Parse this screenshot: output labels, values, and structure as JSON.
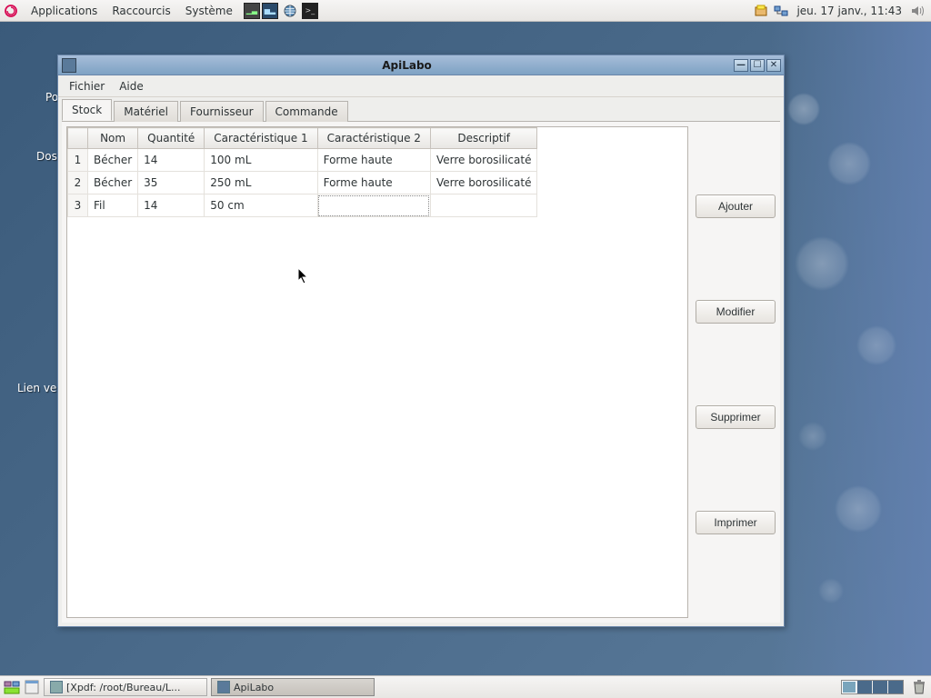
{
  "top_panel": {
    "menus": [
      "Applications",
      "Raccourcis",
      "Système"
    ],
    "clock": "jeu. 17 janv., 11:43"
  },
  "desktop_labels": {
    "poste": "Pos",
    "dossier": "Doss",
    "lien": "Lien ve"
  },
  "window": {
    "title": "ApiLabo",
    "menubar": {
      "fichier": "Fichier",
      "aide": "Aide"
    },
    "tabs": {
      "stock": "Stock",
      "materiel": "Matériel",
      "fournisseur": "Fournisseur",
      "commande": "Commande"
    },
    "table": {
      "headers": {
        "idx": "",
        "nom": "Nom",
        "quantite": "Quantité",
        "c1": "Caractéristique 1",
        "c2": "Caractéristique 2",
        "desc": "Descriptif"
      },
      "rows": [
        {
          "idx": "1",
          "nom": "Bécher",
          "qte": "14",
          "c1": "100 mL",
          "c2": "Forme haute",
          "desc": "Verre borosilicaté"
        },
        {
          "idx": "2",
          "nom": "Bécher",
          "qte": "35",
          "c1": "250 mL",
          "c2": "Forme haute",
          "desc": "Verre borosilicaté"
        },
        {
          "idx": "3",
          "nom": "Fil",
          "qte": "14",
          "c1": "50 cm",
          "c2": "",
          "desc": ""
        }
      ]
    },
    "buttons": {
      "ajouter": "Ajouter",
      "modifier": "Modifier",
      "supprimer": "Supprimer",
      "imprimer": "Imprimer"
    }
  },
  "taskbar": {
    "xpdf": "[Xpdf: /root/Bureau/L...",
    "apilabo": "ApiLabo"
  }
}
